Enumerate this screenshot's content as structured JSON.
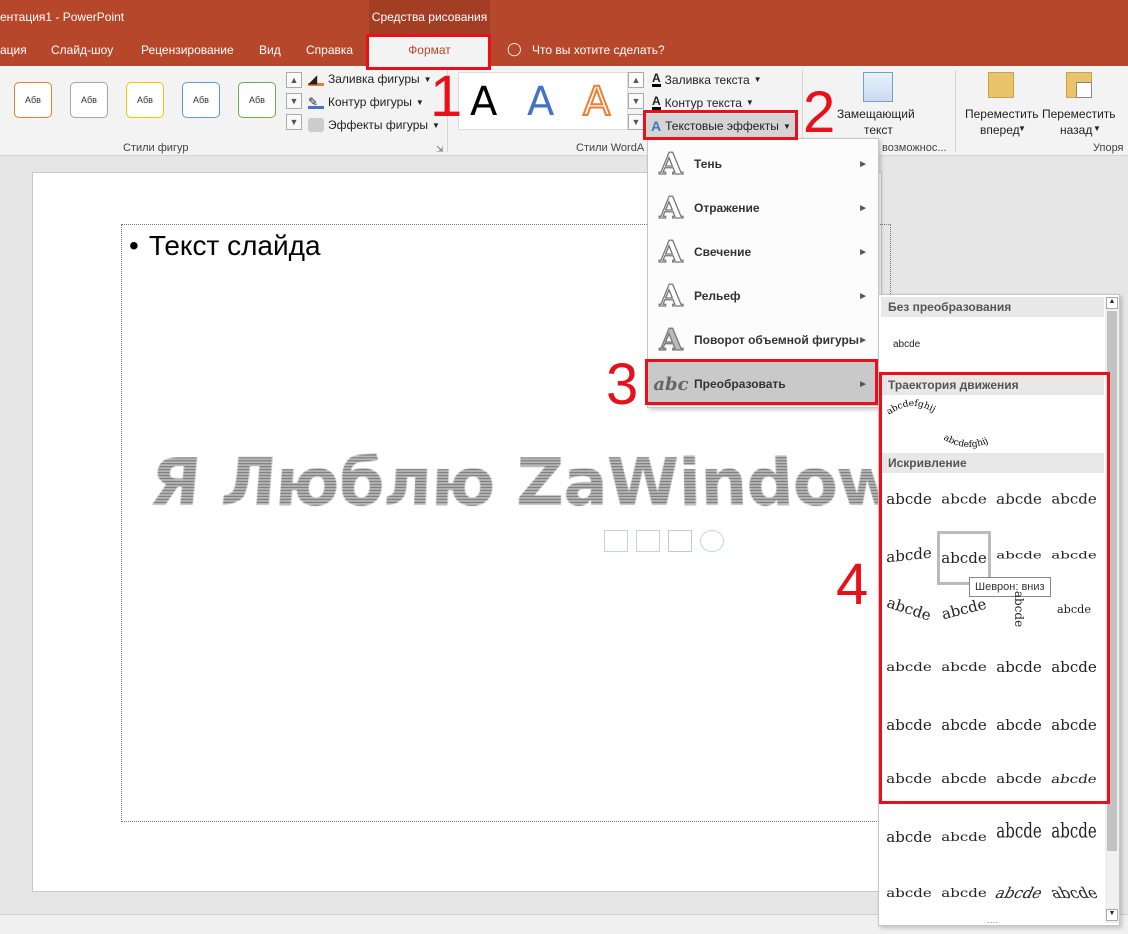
{
  "window": {
    "title": "ентация1  -  PowerPoint",
    "context_tab_group": "Средства рисования"
  },
  "tabs": [
    {
      "label": "ация"
    },
    {
      "label": "Слайд-шоу"
    },
    {
      "label": "Рецензирование"
    },
    {
      "label": "Вид"
    },
    {
      "label": "Справка"
    },
    {
      "label": "Формат"
    }
  ],
  "tell_me": "Что вы хотите сделать?",
  "ribbon": {
    "shape_styles": {
      "swatches": [
        {
          "text": "Абв",
          "border": "#ed7d31"
        },
        {
          "text": "Абв",
          "border": "#a5a5a5"
        },
        {
          "text": "Абв",
          "border": "#ffc000"
        },
        {
          "text": "Абв",
          "border": "#5b9bd5"
        },
        {
          "text": "Абв",
          "border": "#70ad47"
        }
      ],
      "fill": "Заливка фигуры",
      "outline": "Контур фигуры",
      "effects": "Эффекты фигуры",
      "group_label": "Стили фигур"
    },
    "wordart": {
      "samples": [
        {
          "text": "A",
          "color": "#000000"
        },
        {
          "text": "A",
          "color": "#4472c4"
        },
        {
          "text": "A",
          "color": "#ed7d31"
        }
      ],
      "text_fill": "Заливка текста",
      "text_outline": "Контур текста",
      "text_effects": "Текстовые эффекты",
      "group_label": "Стили WordA"
    },
    "alt_text": {
      "line1": "Замещающий",
      "line2": "текст",
      "group_label": "возможнос..."
    },
    "arrange": {
      "forward_line1": "Переместить",
      "forward_line2": "вперед",
      "backward_line1": "Переместить",
      "backward_line2": "назад",
      "group_label": "Упоря"
    }
  },
  "slide": {
    "bullet": "•",
    "body_text": "Текст слайда",
    "wordart_text": "Я Люблю ZaWindows.ru"
  },
  "text_effects_menu": [
    {
      "label": "Тень"
    },
    {
      "label": "Отражение"
    },
    {
      "label": "Свечение"
    },
    {
      "label": "Рельеф"
    },
    {
      "label": "Поворот объемной фигуры"
    },
    {
      "label": "Преобразовать"
    }
  ],
  "transform_gallery": {
    "no_transform_header": "Без преобразования",
    "no_transform_sample": "abcde",
    "follow_path_header": "Траектория движения",
    "warp_header": "Искривление",
    "sample": "abcde",
    "path_sample": "abcdefghij",
    "tooltip": "Шеврон: вниз",
    "more": "...."
  },
  "annotations": [
    "1",
    "2",
    "3",
    "4"
  ],
  "colors": {
    "accent": "#b7472a",
    "highlight_red": "#e8101a"
  }
}
